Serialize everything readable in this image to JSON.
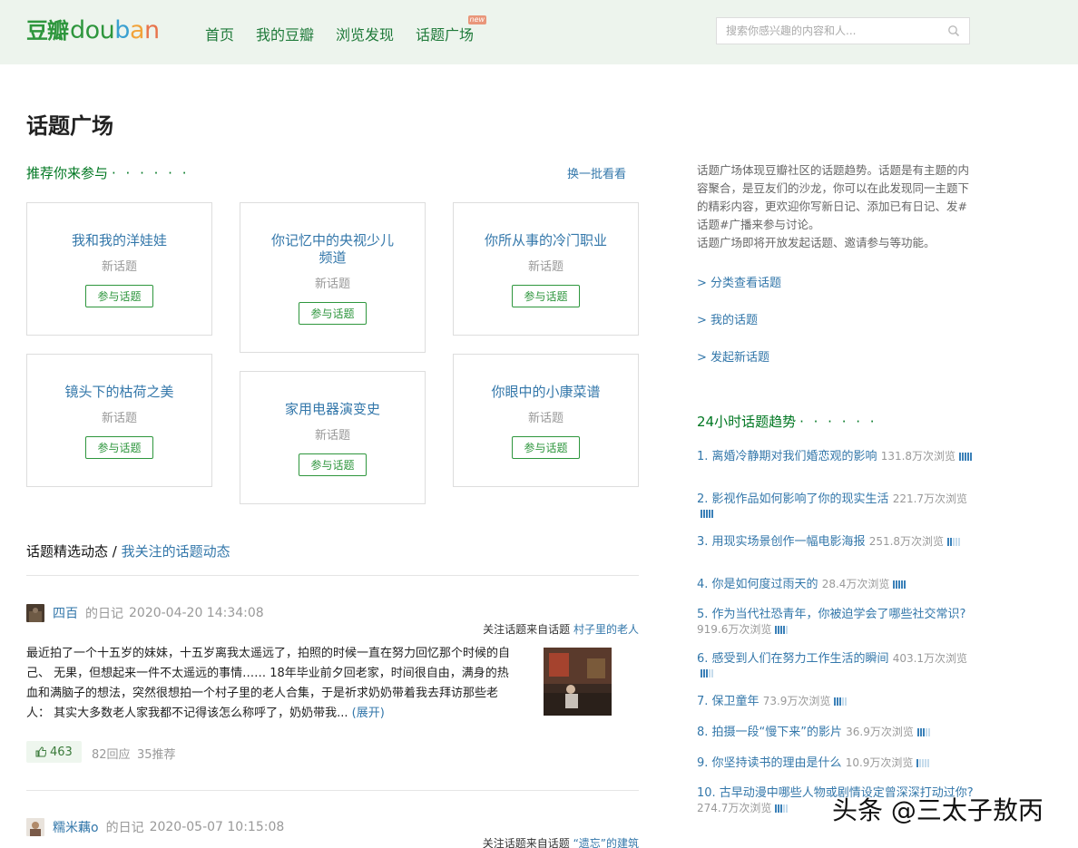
{
  "header": {
    "logo_cn": "豆瓣",
    "logo_en": [
      "d",
      "o",
      "u",
      "b",
      "a",
      "n"
    ],
    "nav": [
      "首页",
      "我的豆瓣",
      "浏览发现",
      "话题广场"
    ],
    "new_badge": "new",
    "search_placeholder": "搜索你感兴趣的内容和人..."
  },
  "page": {
    "title": "话题广场"
  },
  "recommend": {
    "heading": "推荐你来参与",
    "dots": "· · · · · ·",
    "refresh": "换一批看看",
    "cards": [
      {
        "title": "我和我的洋娃娃",
        "sub": "新话题",
        "button": "参与话题"
      },
      {
        "title": "你记忆中的央视少儿频道",
        "sub": "新话题",
        "button": "参与话题"
      },
      {
        "title": "你所从事的冷门职业",
        "sub": "新话题",
        "button": "参与话题"
      },
      {
        "title": "镜头下的枯荷之美",
        "sub": "新话题",
        "button": "参与话题"
      },
      {
        "title": "家用电器演变史",
        "sub": "新话题",
        "button": "参与话题"
      },
      {
        "title": "你眼中的小康菜谱",
        "sub": "新话题",
        "button": "参与话题"
      }
    ]
  },
  "feed": {
    "heading": "话题精选动态",
    "separator": "/",
    "following": "我关注的话题动态",
    "posts": [
      {
        "author": "四百",
        "kind": "的日记",
        "time": "2020-04-20 14:34:08",
        "from_label": "关注话题来自话题",
        "topic": "村子里的老人",
        "body": "最近拍了一个十五岁的妹妹，十五岁离我太遥远了，拍照的时候一直在努力回忆那个时候的自己、 无果，但想起来一件不太遥远的事情…… 18年毕业前夕回老家，时间很自由，满身的热血和满脑子的想法，突然很想拍一个村子里的老人合集，于是祈求奶奶带着我去拜访那些老人： 其实大多数老人家我都不记得该怎么称呼了，奶奶带我...",
        "expand": "(展开)",
        "likes": "463",
        "replies": "82回应",
        "recs": "35推荐"
      },
      {
        "author": "糯米藕o",
        "kind": "的日记",
        "time": "2020-05-07 10:15:08",
        "from_label": "关注话题来自话题",
        "topic": "“遗忘”的建筑"
      }
    ]
  },
  "sidebar": {
    "intro": "话题广场体现豆瓣社区的话题趋势。话题是有主题的内容聚合，是豆友们的沙龙，你可以在此发现同一主题下的精彩内容，更欢迎你写新日记、添加已有日记、发#话题#广播来参与讨论。",
    "intro2": "话题广场即将开放发起话题、邀请参与等功能。",
    "links": [
      "> 分类查看话题",
      "> 我的话题",
      "> 发起新话题"
    ],
    "trend_heading": "24小时话题趋势",
    "trend_dots": "· · · · · ·",
    "trends": [
      {
        "label": "1. 离婚冷静期对我们婚恋观的影响",
        "count": "131.8万次浏览",
        "level": 5
      },
      {
        "label": "2. 影视作品如何影响了你的现实生活",
        "count": "221.7万次浏览",
        "level": 5
      },
      {
        "label": "3. 用现实场景创作一幅电影海报",
        "count": "251.8万次浏览",
        "level": 2
      },
      {
        "label": "4. 你是如何度过雨天的",
        "count": "28.4万次浏览",
        "level": 5
      },
      {
        "label": "5. 作为当代社恐青年，你被迫学会了哪些社交常识?",
        "count": "919.6万次浏览",
        "level": 4
      },
      {
        "label": "6. 感受到人们在努力工作生活的瞬间",
        "count": "403.1万次浏览",
        "level": 3
      },
      {
        "label": "7. 保卫童年",
        "count": "73.9万次浏览",
        "level": 3
      },
      {
        "label": "8. 拍摄一段“慢下来”的影片",
        "count": "36.9万次浏览",
        "level": 3
      },
      {
        "label": "9. 你坚持读书的理由是什么",
        "count": "10.9万次浏览",
        "level": 1
      },
      {
        "label": "10. 古早动漫中哪些人物或剧情设定曾深深打动过你?",
        "count": "274.7万次浏览",
        "level": 3
      }
    ]
  },
  "watermark": "头条 @三太子敖丙",
  "colors": {
    "header_bg": "#edf4ed",
    "green": "#2e963d",
    "link": "#3377aa"
  }
}
